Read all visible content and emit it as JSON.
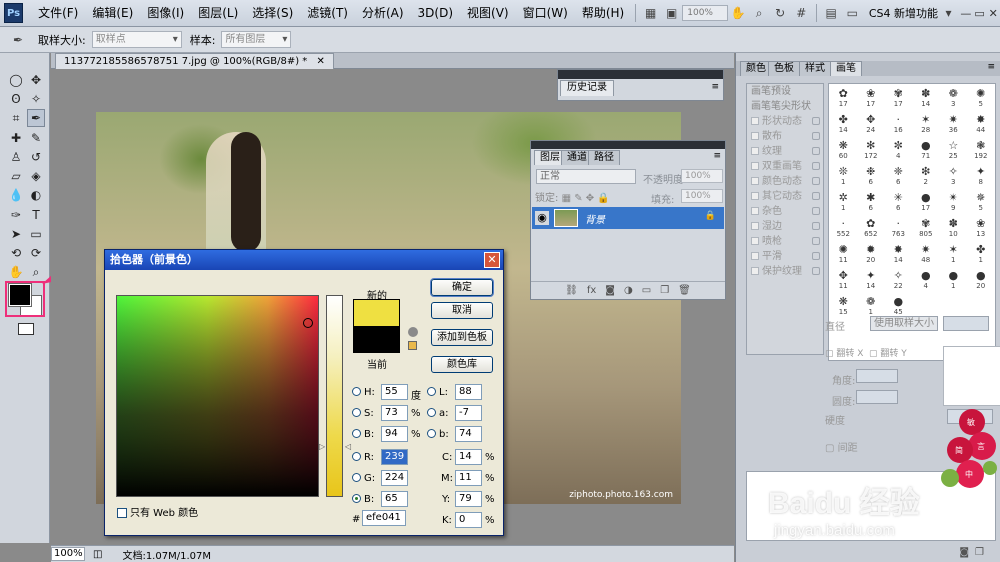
{
  "menubar": {
    "logo": "Ps",
    "items": [
      "文件(F)",
      "编辑(E)",
      "图像(I)",
      "图层(L)",
      "选择(S)",
      "滤镜(T)",
      "分析(A)",
      "3D(D)",
      "视图(V)",
      "窗口(W)",
      "帮助(H)"
    ],
    "zoom": "100%",
    "workspace": "CS4 新增功能",
    "window_buttons": [
      "—",
      "▭",
      "✕"
    ]
  },
  "options": {
    "sample_size_label": "取样大小:",
    "sample_size_value": "取样点",
    "sample_label": "样本:",
    "sample_value": "所有图层"
  },
  "document": {
    "tab_title": "113772185586578751 7.jpg @ 100%(RGB/8#) *",
    "tab_close": "✕",
    "watermark": "ziphoto.photo.163.com"
  },
  "statusbar": {
    "zoom": "100%",
    "doc_info": "文档:1.07M/1.07M"
  },
  "history_panel": {
    "tab": "历史记录"
  },
  "layers_panel": {
    "tabs": [
      "图层",
      "通道",
      "路径"
    ],
    "blend_mode": "正常",
    "opacity_label": "不透明度:",
    "opacity_value": "100%",
    "lock_label": "锁定:",
    "fill_label": "填充:",
    "fill_value": "100%",
    "layer_name": "背景",
    "footer_icons": [
      "link-icon",
      "fx-icon",
      "mask-icon",
      "adjustment-icon",
      "group-icon",
      "new-layer-icon",
      "trash-icon"
    ]
  },
  "right_dock": {
    "tabs": [
      "颜色",
      "色板",
      "样式",
      "画笔"
    ],
    "brush_options": [
      "画笔预设",
      "画笔笔尖形状",
      "形状动态",
      "散布",
      "纹理",
      "双重画笔",
      "颜色动态",
      "其它动态",
      "杂色",
      "湿边",
      "喷枪",
      "平滑",
      "保护纹理"
    ],
    "brushes": [
      {
        "g": "✿",
        "n": "17"
      },
      {
        "g": "❀",
        "n": "17"
      },
      {
        "g": "✾",
        "n": "17"
      },
      {
        "g": "✽",
        "n": "14"
      },
      {
        "g": "❁",
        "n": "3"
      },
      {
        "g": "✺",
        "n": "5"
      },
      {
        "g": "✤",
        "n": "14"
      },
      {
        "g": "✥",
        "n": "24"
      },
      {
        "g": "·",
        "n": "16"
      },
      {
        "g": "✶",
        "n": "28"
      },
      {
        "g": "✷",
        "n": "36"
      },
      {
        "g": "✸",
        "n": "44"
      },
      {
        "g": "❋",
        "n": "60"
      },
      {
        "g": "✻",
        "n": "172"
      },
      {
        "g": "✼",
        "n": "4"
      },
      {
        "g": "●",
        "n": "71"
      },
      {
        "g": "☆",
        "n": "25"
      },
      {
        "g": "❃",
        "n": "192"
      },
      {
        "g": "❊",
        "n": "1"
      },
      {
        "g": "❉",
        "n": "6"
      },
      {
        "g": "❈",
        "n": "6"
      },
      {
        "g": "❇",
        "n": "2"
      },
      {
        "g": "✧",
        "n": "3"
      },
      {
        "g": "✦",
        "n": "8"
      },
      {
        "g": "✲",
        "n": "1"
      },
      {
        "g": "✱",
        "n": "6"
      },
      {
        "g": "✳",
        "n": "6"
      },
      {
        "g": "●",
        "n": "17"
      },
      {
        "g": "✴",
        "n": "9"
      },
      {
        "g": "✵",
        "n": "5"
      },
      {
        "g": "·",
        "n": "552"
      },
      {
        "g": "✿",
        "n": "652"
      },
      {
        "g": "·",
        "n": "763"
      },
      {
        "g": "✾",
        "n": "805"
      },
      {
        "g": "✽",
        "n": "10"
      },
      {
        "g": "❀",
        "n": "13"
      },
      {
        "g": "✺",
        "n": "11"
      },
      {
        "g": "✹",
        "n": "20"
      },
      {
        "g": "✸",
        "n": "14"
      },
      {
        "g": "✷",
        "n": "48"
      },
      {
        "g": "✶",
        "n": "1"
      },
      {
        "g": "✤",
        "n": "1"
      },
      {
        "g": "✥",
        "n": "11"
      },
      {
        "g": "✦",
        "n": "14"
      },
      {
        "g": "✧",
        "n": "22"
      },
      {
        "g": "●",
        "n": "4"
      },
      {
        "g": "●",
        "n": "1"
      },
      {
        "g": "●",
        "n": "20"
      },
      {
        "g": "❋",
        "n": "15"
      },
      {
        "g": "❁",
        "n": "1"
      },
      {
        "g": "●",
        "n": "45"
      },
      {
        "g": "",
        "n": ""
      },
      {
        "g": "",
        "n": ""
      },
      {
        "g": "",
        "n": ""
      }
    ],
    "diameter_label": "直径",
    "use_sample_size": "使用取样大小",
    "flip_x": "翻转 X",
    "flip_y": "翻转 Y",
    "angle_label": "角度:",
    "roundness_label": "圆度:",
    "hardness_label": "硬度",
    "spacing_label": "间距"
  },
  "picker": {
    "title": "拾色器（前景色）",
    "close": "✕",
    "new_label": "新的",
    "current_label": "当前",
    "ok": "确定",
    "cancel": "取消",
    "add_to_swatches": "添加到色板",
    "color_libraries": "颜色库",
    "fields": {
      "H": "55",
      "S": "73",
      "B": "94",
      "R": "239",
      "G": "224",
      "Bv": "65",
      "L": "88",
      "a": "-7",
      "b": "74",
      "C": "14",
      "M": "11",
      "Y": "79",
      "K": "0"
    },
    "units": {
      "deg": "度",
      "pct": "%"
    },
    "labels": {
      "H": "H:",
      "S": "S:",
      "B": "B:",
      "R": "R:",
      "G": "G:",
      "Bv": "B:",
      "L": "L:",
      "a": "a:",
      "b": "b:",
      "C": "C:",
      "M": "M:",
      "Y": "Y:",
      "K": "K:"
    },
    "hex_label": "#",
    "hex": "efe041",
    "web_only": "只有 Web 颜色",
    "new_color": "#efe041",
    "current_color": "#000000"
  },
  "baidu": {
    "logo_text": "Baidu 经验",
    "url": "jingyan.baidu.com",
    "seal_chars": [
      "敏",
      "言",
      "简",
      "中"
    ]
  }
}
